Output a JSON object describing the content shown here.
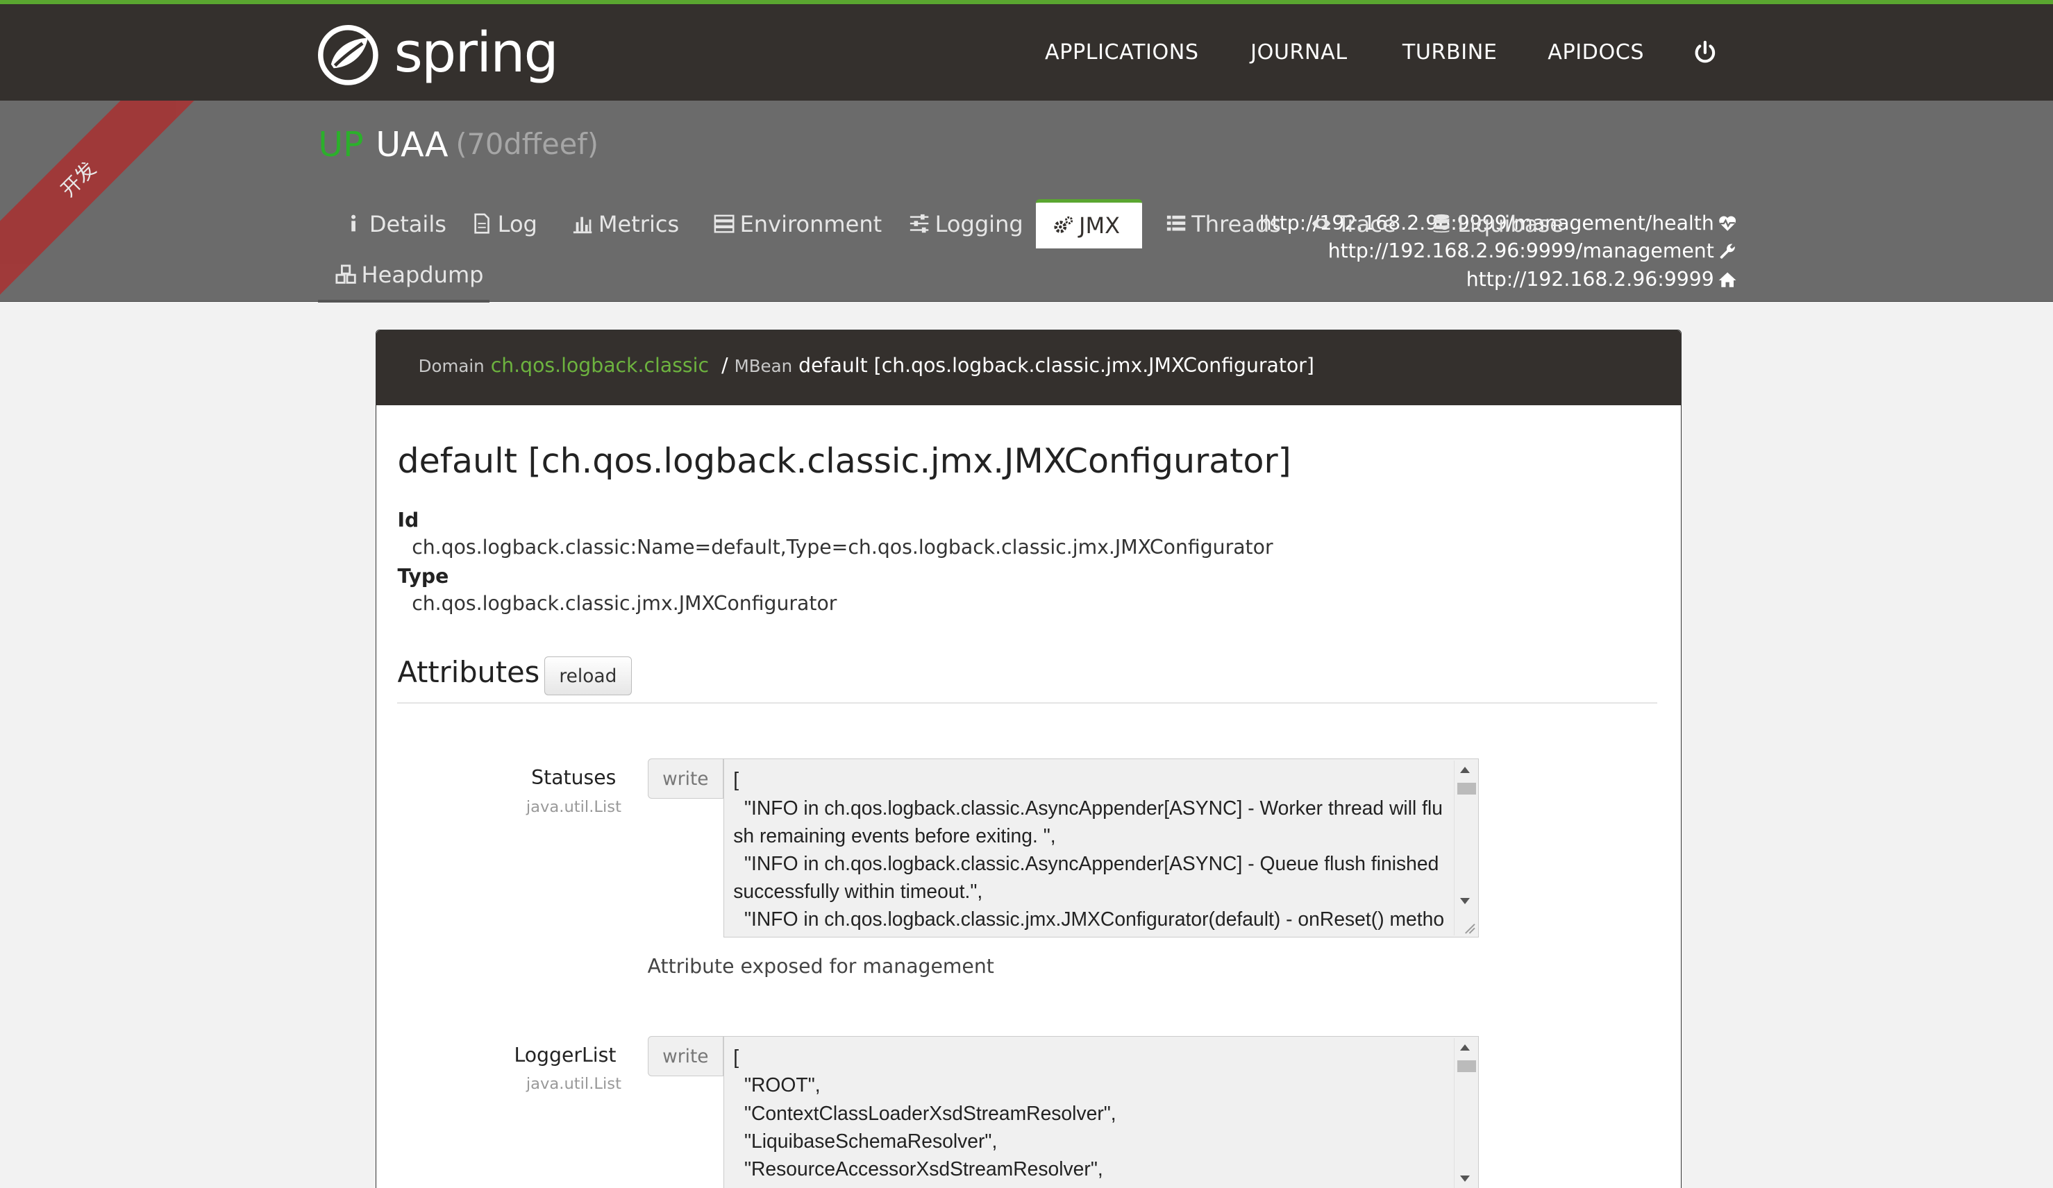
{
  "nav": {
    "brand": "spring",
    "links": [
      "APPLICATIONS",
      "JOURNAL",
      "TURBINE",
      "APIDOCS"
    ],
    "power_icon": "power-icon"
  },
  "ribbon": "开发",
  "app": {
    "status": "UP",
    "name": "UAA",
    "id": "(70dffeef)",
    "urls": [
      {
        "text": "http://192.168.2.96:9999/management/health",
        "icon": "heartbeat-icon"
      },
      {
        "text": "http://192.168.2.96:9999/management",
        "icon": "wrench-icon"
      },
      {
        "text": "http://192.168.2.96:9999",
        "icon": "home-icon"
      }
    ]
  },
  "tabs": [
    {
      "label": "Details",
      "icon": "info-icon"
    },
    {
      "label": "Log",
      "icon": "file-icon"
    },
    {
      "label": "Metrics",
      "icon": "bar-chart-icon"
    },
    {
      "label": "Environment",
      "icon": "server-icon"
    },
    {
      "label": "Logging",
      "icon": "sliders-icon"
    },
    {
      "label": "JMX",
      "icon": "cogs-icon",
      "active": true
    },
    {
      "label": "Threads",
      "icon": "list-icon"
    },
    {
      "label": "Trace",
      "icon": "eye-icon"
    },
    {
      "label": "Liquibase",
      "icon": "database-icon"
    },
    {
      "label": "Heapdump",
      "icon": "cubes-icon"
    }
  ],
  "breadcrumb": {
    "domain_label": "Domain",
    "domain": "ch.qos.logback.classic",
    "separator": "/",
    "mbean_label": "MBean",
    "mbean": "default [ch.qos.logback.classic.jmx.JMXConfigurator]"
  },
  "mbean": {
    "title": "default [ch.qos.logback.classic.jmx.JMXConfigurator]",
    "id_label": "Id",
    "id": "ch.qos.logback.classic:Name=default,Type=ch.qos.logback.classic.jmx.JMXConfigurator",
    "type_label": "Type",
    "type": "ch.qos.logback.classic.jmx.JMXConfigurator"
  },
  "attributes": {
    "heading": "Attributes",
    "reload_label": "reload",
    "items": [
      {
        "name": "Statuses",
        "type": "java.util.List",
        "write_label": "write",
        "value": "[\n  \"INFO in ch.qos.logback.classic.AsyncAppender[ASYNC] - Worker thread will flush remaining events before exiting. \",\n  \"INFO in ch.qos.logback.classic.AsyncAppender[ASYNC] - Queue flush finished successfully within timeout.\",\n  \"INFO in ch.qos.logback.classic.jmx.JMXConfigurator(default) - onReset() metho",
        "description": "Attribute exposed for management"
      },
      {
        "name": "LoggerList",
        "type": "java.util.List",
        "write_label": "write",
        "value": "[\n  \"ROOT\",\n  \"ContextClassLoaderXsdStreamResolver\",\n  \"LiquibaseSchemaResolver\",\n  \"ResourceAccessorXsdStreamResolver\","
      }
    ]
  }
}
